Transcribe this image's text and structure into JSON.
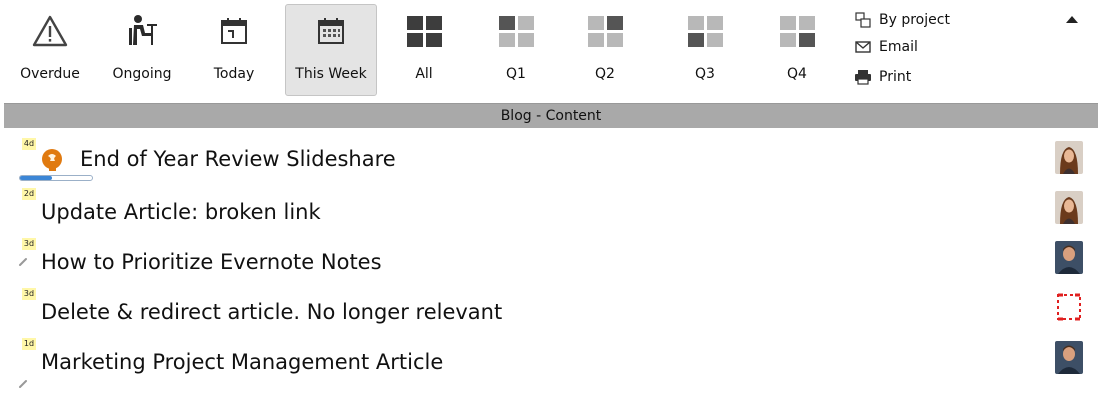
{
  "toolbar": {
    "buttons": [
      {
        "label": "Overdue",
        "icon": "warning-icon"
      },
      {
        "label": "Ongoing",
        "icon": "person-at-desk-icon"
      },
      {
        "label": "Today",
        "icon": "calendar-day-icon"
      },
      {
        "label": "This Week",
        "icon": "calendar-week-icon",
        "active": true
      },
      {
        "label": "All",
        "icon": "grid-all-icon"
      },
      {
        "label": "Q1",
        "icon": "grid-q1-icon"
      },
      {
        "label": "Q2",
        "icon": "grid-q2-icon"
      },
      {
        "label": "Q3",
        "icon": "grid-q3-icon"
      },
      {
        "label": "Q4",
        "icon": "grid-q4-icon"
      }
    ],
    "links": [
      {
        "label": "By project",
        "icon": "group-icon"
      },
      {
        "label": "Email",
        "icon": "envelope-icon"
      },
      {
        "label": "Print",
        "icon": "printer-icon"
      }
    ]
  },
  "section": {
    "title": "Blog - Content"
  },
  "tasks": [
    {
      "badge": "4d",
      "title": "End of Year Review Slideshare",
      "avatar": "woman-avatar",
      "progress": 0.45
    },
    {
      "badge": "2d",
      "title": "Update Article: broken link",
      "avatar": "woman-avatar"
    },
    {
      "badge": "3d",
      "title": "How to Prioritize Evernote Notes",
      "avatar": "man-avatar"
    },
    {
      "badge": "3d",
      "title": "Delete & redirect article. No longer relevant",
      "avatar": "broken-image-icon"
    },
    {
      "badge": "1d",
      "title": "Marketing Project Management Article",
      "avatar": "man-avatar"
    }
  ],
  "colors": {
    "section_bg": "#a9a9a9",
    "active_btn_bg": "#e4e4e4",
    "badge_bg": "#fff7a8",
    "progress_fill": "#3c86d6",
    "brain_icon": "#e07a10"
  }
}
